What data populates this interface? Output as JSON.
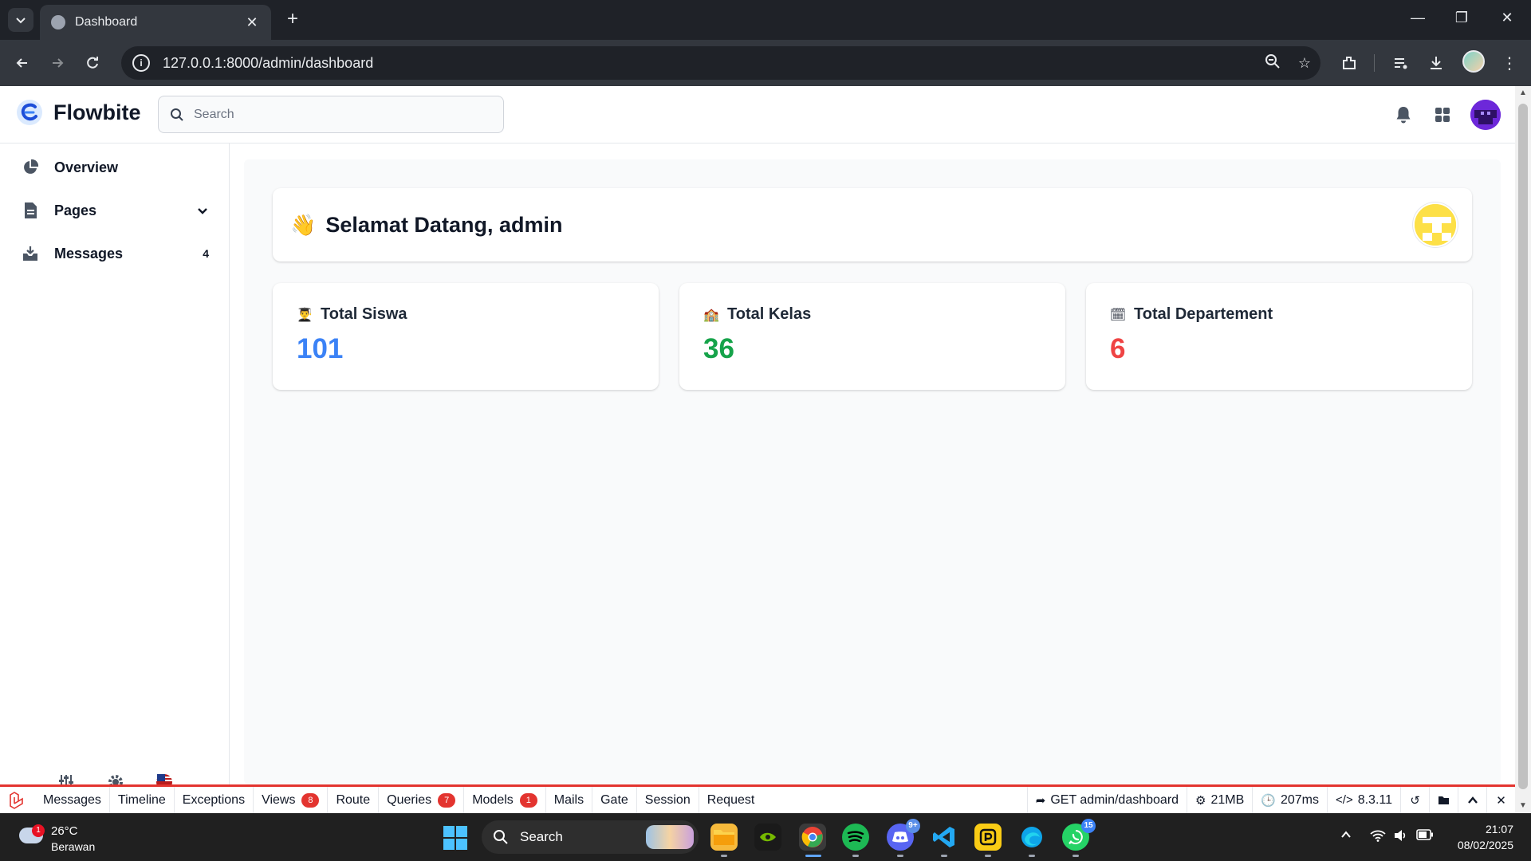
{
  "browser": {
    "tab_title": "Dashboard",
    "url": "127.0.0.1:8000/admin/dashboard"
  },
  "app": {
    "brand": "Flowbite",
    "search_placeholder": "Search"
  },
  "sidebar": {
    "items": [
      {
        "label": "Overview",
        "icon": "chart-pie-icon"
      },
      {
        "label": "Pages",
        "icon": "document-icon"
      },
      {
        "label": "Messages",
        "icon": "inbox-in-icon",
        "badge": "4"
      }
    ]
  },
  "main": {
    "welcome_emoji": "👋",
    "welcome_title": "Selamat Datang, admin",
    "stats": [
      {
        "emoji": "👨‍🎓",
        "label": "Total Siswa",
        "value": "101",
        "color": "#3b82f6"
      },
      {
        "emoji": "🏫",
        "label": "Total Kelas",
        "value": "36",
        "color": "#16a34a"
      },
      {
        "emoji": "🗓",
        "label": "Total Departement",
        "value": "6",
        "color": "#ef4444"
      }
    ]
  },
  "debugbar": {
    "tabs": [
      {
        "label": "Messages"
      },
      {
        "label": "Timeline"
      },
      {
        "label": "Exceptions"
      },
      {
        "label": "Views",
        "badge": "8"
      },
      {
        "label": "Route"
      },
      {
        "label": "Queries",
        "badge": "7"
      },
      {
        "label": "Models",
        "badge": "1"
      },
      {
        "label": "Mails"
      },
      {
        "label": "Gate"
      },
      {
        "label": "Session"
      },
      {
        "label": "Request"
      }
    ],
    "route": "GET admin/dashboard",
    "memory": "21MB",
    "time": "207ms",
    "php_version": "8.3.11",
    "accent_color": "#e3342f"
  },
  "taskbar": {
    "weather_temp": "26°C",
    "weather_desc": "Berawan",
    "weather_alert": "1",
    "search_label": "Search",
    "discord_badge": "9+",
    "whatsapp_badge": "15",
    "time": "21:07",
    "date": "08/02/2025"
  }
}
